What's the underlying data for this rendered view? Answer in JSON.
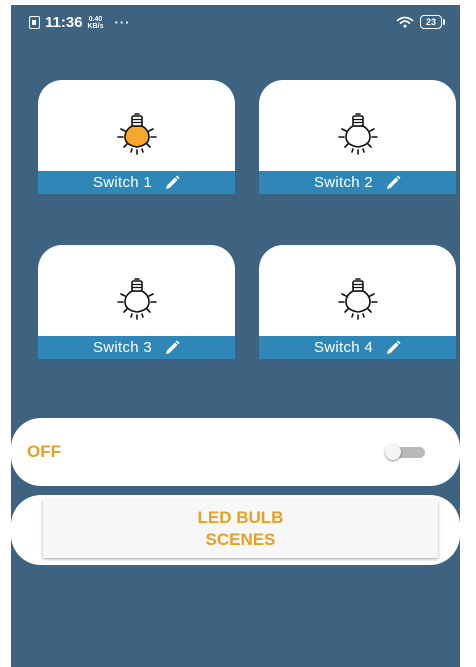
{
  "status_bar": {
    "time": "11:36",
    "net_speed_value": "0.40",
    "net_speed_unit": "KB/s",
    "more": "···",
    "battery": "23",
    "icons": [
      "sim-icon",
      "wifi-icon",
      "battery-icon"
    ]
  },
  "switches": [
    {
      "label": "Switch 1",
      "bulb_on": true
    },
    {
      "label": "Switch 2",
      "bulb_on": false
    },
    {
      "label": "Switch 3",
      "bulb_on": false
    },
    {
      "label": "Switch 4",
      "bulb_on": false
    }
  ],
  "master": {
    "label": "OFF",
    "toggle_on": false
  },
  "scenes": {
    "line1": "LED BULB",
    "line2": "SCENES"
  },
  "colors": {
    "background": "#3d6381",
    "label_bar": "#2f87b7",
    "accent": "#e6a024",
    "bulb_on": "#f5a72e"
  }
}
